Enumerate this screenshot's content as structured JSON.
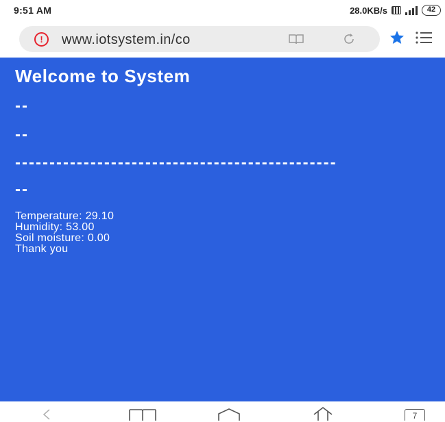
{
  "status_bar": {
    "time": "9:51 AM",
    "net_speed": "28.0KB/s",
    "battery": "42",
    "icons": [
      "data-saver-icon",
      "signal-icon",
      "battery-icon"
    ]
  },
  "address_bar": {
    "url": "www.iotsystem.in/co",
    "icons": [
      "warning-icon",
      "reader-mode-icon",
      "refresh-icon",
      "bookmark-star-icon",
      "menu-icon"
    ],
    "star_color": "#1a73e8",
    "warning_color": "#e6222d"
  },
  "page": {
    "background": "#2b60de",
    "heading": "Welcome to System",
    "line1": "--",
    "line2": "--",
    "separator": "-----------------------------------------------",
    "line3": "--",
    "readings": [
      "Temperature: 29.10",
      "Humidity: 53.00",
      "Soil moisture: 0.00",
      "Thank you"
    ]
  },
  "navigation": {
    "tab_count": "7",
    "icons": [
      "back-icon",
      "bookmarks-icon",
      "home-icon",
      "share-icon",
      "tabs-icon"
    ]
  }
}
